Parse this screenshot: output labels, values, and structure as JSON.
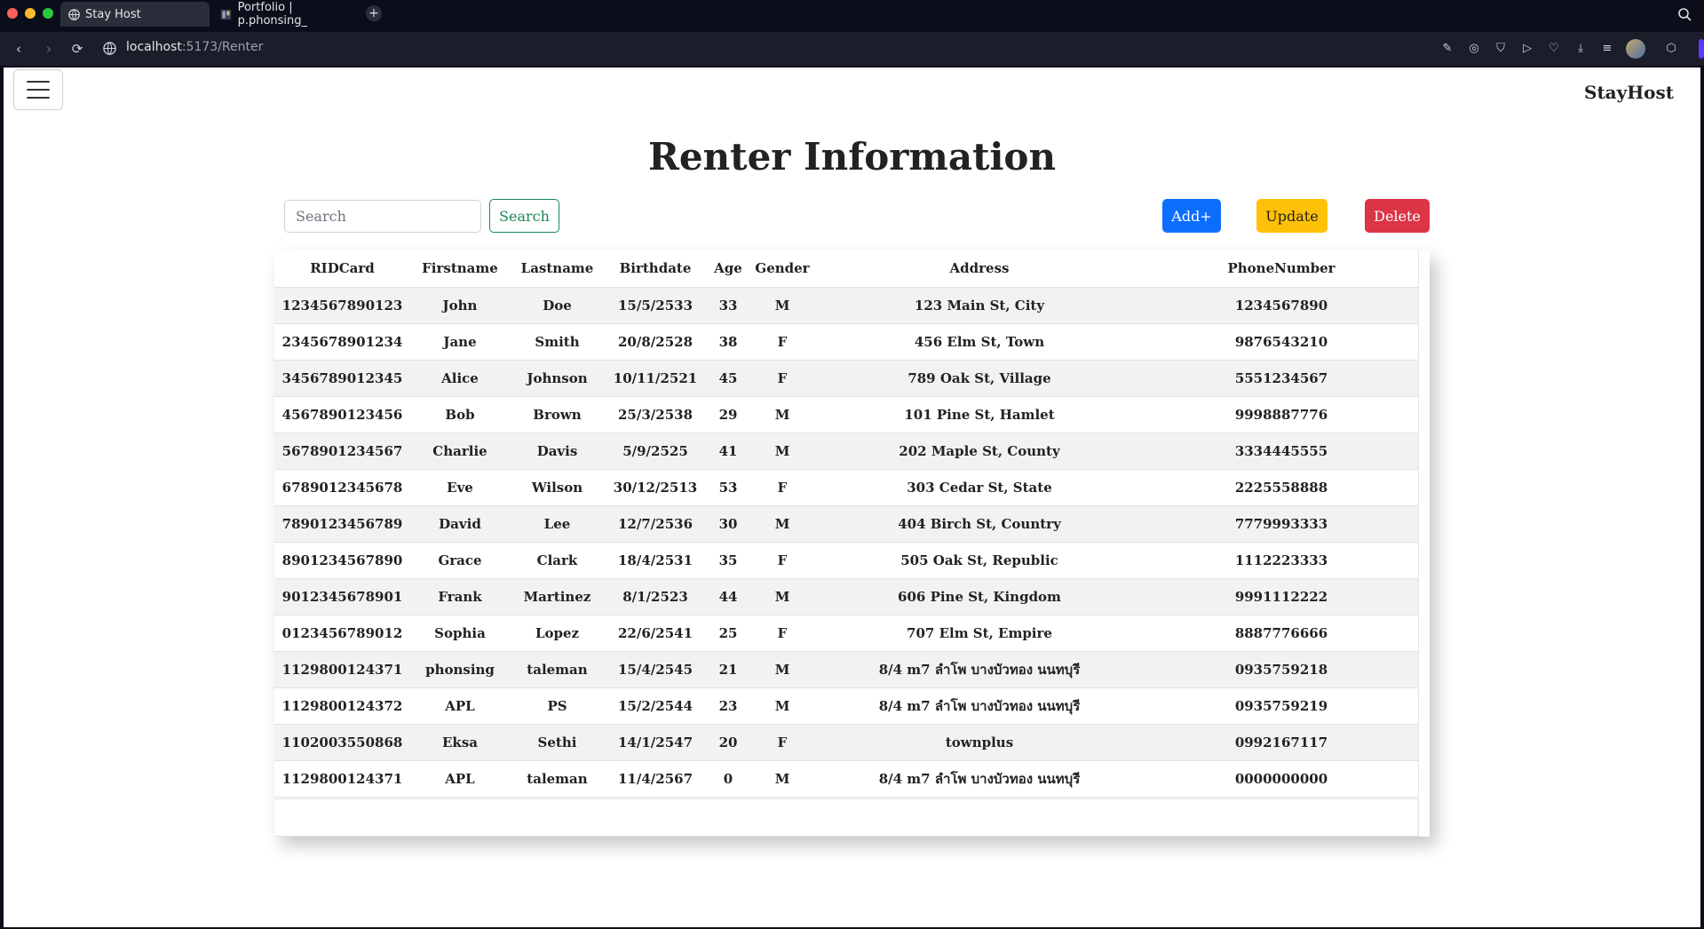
{
  "browser": {
    "tabs": [
      {
        "label": "Stay Host",
        "active": true
      },
      {
        "label": "Portfolio | p.phonsing_",
        "active": false
      }
    ],
    "url_host": "localhost",
    "url_path": ":5173/Renter"
  },
  "header": {
    "brand": "StayHost"
  },
  "page": {
    "title": "Renter Information",
    "search_placeholder": "Search",
    "search_button": "Search",
    "add_button": "Add+",
    "update_button": "Update",
    "delete_button": "Delete"
  },
  "colors": {
    "add": "#0d6efd",
    "update": "#ffc107",
    "delete": "#dc3545",
    "search": "#198754"
  },
  "table": {
    "headers": [
      "RIDCard",
      "Firstname",
      "Lastname",
      "Birthdate",
      "Age",
      "Gender",
      "Address",
      "PhoneNumber"
    ],
    "rows": [
      [
        "1234567890123",
        "John",
        "Doe",
        "15/5/2533",
        "33",
        "M",
        "123 Main St, City",
        "1234567890"
      ],
      [
        "2345678901234",
        "Jane",
        "Smith",
        "20/8/2528",
        "38",
        "F",
        "456 Elm St, Town",
        "9876543210"
      ],
      [
        "3456789012345",
        "Alice",
        "Johnson",
        "10/11/2521",
        "45",
        "F",
        "789 Oak St, Village",
        "5551234567"
      ],
      [
        "4567890123456",
        "Bob",
        "Brown",
        "25/3/2538",
        "29",
        "M",
        "101 Pine St, Hamlet",
        "9998887776"
      ],
      [
        "5678901234567",
        "Charlie",
        "Davis",
        "5/9/2525",
        "41",
        "M",
        "202 Maple St, County",
        "3334445555"
      ],
      [
        "6789012345678",
        "Eve",
        "Wilson",
        "30/12/2513",
        "53",
        "F",
        "303 Cedar St, State",
        "2225558888"
      ],
      [
        "7890123456789",
        "David",
        "Lee",
        "12/7/2536",
        "30",
        "M",
        "404 Birch St, Country",
        "7779993333"
      ],
      [
        "8901234567890",
        "Grace",
        "Clark",
        "18/4/2531",
        "35",
        "F",
        "505 Oak St, Republic",
        "1112223333"
      ],
      [
        "9012345678901",
        "Frank",
        "Martinez",
        "8/1/2523",
        "44",
        "M",
        "606 Pine St, Kingdom",
        "9991112222"
      ],
      [
        "0123456789012",
        "Sophia",
        "Lopez",
        "22/6/2541",
        "25",
        "F",
        "707 Elm St, Empire",
        "8887776666"
      ],
      [
        "1129800124371",
        "phonsing",
        "taleman",
        "15/4/2545",
        "21",
        "M",
        "8/4 m7 ลำโพ บางบัวทอง นนทบุรี",
        "0935759218"
      ],
      [
        "1129800124372",
        "APL",
        "PS",
        "15/2/2544",
        "23",
        "M",
        "8/4 m7 ลำโพ บางบัวทอง นนทบุรี",
        "0935759219"
      ],
      [
        "1102003550868",
        "Eksa",
        "Sethi",
        "14/1/2547",
        "20",
        "F",
        "townplus",
        "0992167117"
      ],
      [
        "1129800124371",
        "APL",
        "taleman",
        "11/4/2567",
        "0",
        "M",
        "8/4 m7 ลำโพ บางบัวทอง นนทบุรี",
        "0000000000"
      ]
    ]
  }
}
